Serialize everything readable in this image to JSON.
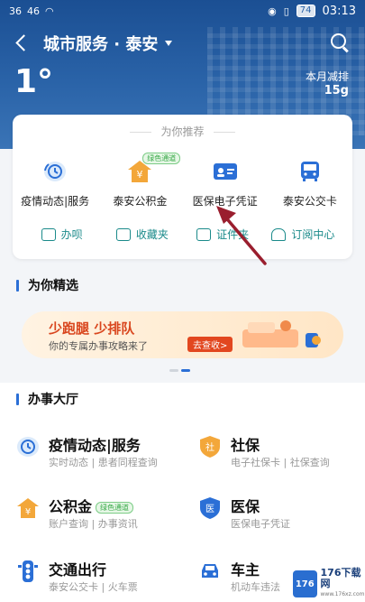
{
  "status_bar": {
    "signal_left": "36",
    "signal_right": "46",
    "battery": "74",
    "time": "03:13"
  },
  "header": {
    "title": "城市服务 · 泰安",
    "temperature": "1°",
    "limit_label": "本月减排",
    "limit_value": "15g"
  },
  "recommend": {
    "title": "为你推荐",
    "items": [
      {
        "label": "疫情动态|服务",
        "icon": "clock-icon"
      },
      {
        "label": "泰安公积金",
        "icon": "house-fund-icon",
        "badge": "绿色通道"
      },
      {
        "label": "医保电子凭证",
        "icon": "id-card-icon"
      },
      {
        "label": "泰安公交卡",
        "icon": "bus-icon"
      }
    ],
    "quick": [
      {
        "label": "办呗",
        "icon": "task-icon"
      },
      {
        "label": "收藏夹",
        "icon": "folder-icon"
      },
      {
        "label": "证件夹",
        "icon": "card-folder-icon"
      },
      {
        "label": "订阅中心",
        "icon": "bell-icon"
      }
    ]
  },
  "featured": {
    "title": "为你精选",
    "banner_title": "少跑腿 少排队",
    "banner_sub": "你的专属办事攻略来了",
    "banner_button": "去查收>"
  },
  "hall": {
    "title": "办事大厅",
    "items": [
      {
        "title": "疫情动态|服务",
        "sub": "实时动态 | 患者同程查询",
        "icon": "clock-icon"
      },
      {
        "title": "社保",
        "sub": "电子社保卡 | 社保查询",
        "icon": "social-security-icon"
      },
      {
        "title": "公积金",
        "sub": "账户查询 | 办事资讯",
        "icon": "house-fund-icon",
        "badge": "绿色通道"
      },
      {
        "title": "医保",
        "sub": "医保电子凭证",
        "icon": "medical-icon"
      },
      {
        "title": "交通出行",
        "sub": "泰安公交卡 | 火车票",
        "icon": "traffic-light-icon"
      },
      {
        "title": "车主",
        "sub": "机动车违法",
        "icon": "car-icon"
      }
    ]
  },
  "watermark": {
    "logo_text": "176",
    "name": "176下载网",
    "site": "www.176xz.com"
  },
  "colors": {
    "header_blue": "#2a63a8",
    "accent_blue": "#2b6fd6",
    "teal": "#1a8a8a",
    "banner_red": "#e2471f"
  }
}
